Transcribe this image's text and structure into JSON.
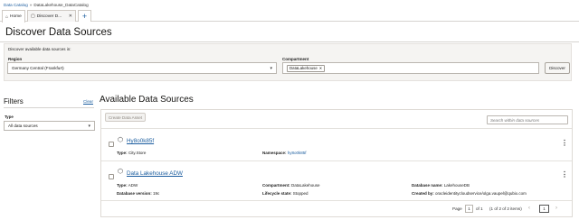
{
  "breadcrumb": {
    "root": "Data Catalog",
    "separator": "»",
    "current": "DataLakehouse_DataCatalog"
  },
  "tabs": [
    {
      "label": "Home"
    },
    {
      "label": "Discover D..."
    }
  ],
  "page_title": "Discover Data Sources",
  "discover": {
    "intro": "Discover available data sources in:",
    "region_label": "Region",
    "region_value": "Germany Central (Frankfurt)",
    "compartment_label": "Compartment",
    "compartment_chip": "DataLakehouse",
    "discover_button": "Discover"
  },
  "filters": {
    "title": "Filters",
    "clear": "Clear",
    "type_label": "Type",
    "type_value": "All data sources"
  },
  "sources": {
    "title": "Available Data Sources",
    "create_button": "Create Data Asset",
    "search_placeholder": "Search within data sources",
    "items": [
      {
        "name": "Hy8o0k85f",
        "type_label": "Type:",
        "type_value": "City.Store",
        "ns_label": "Namespace:",
        "ns_value": "hy8o0k85f"
      },
      {
        "name": "Data Lakehouse ADW",
        "type_label": "Type:",
        "type_value": "ADW",
        "comp_label": "Compartment:",
        "comp_value": "DataLakehouse",
        "dbname_label": "Database name:",
        "dbname_value": "LakehouseDB",
        "dbver_label": "Database version:",
        "dbver_value": "19c",
        "life_label": "Lifecycle state:",
        "life_value": "Stopped",
        "created_label": "Created by:",
        "created_value": "oracleidentitycloudservice/olga.vaupel@qubix.com"
      }
    ],
    "pagination": {
      "page_label": "Page",
      "page_value": "1",
      "of_text": "of 1",
      "count_text": "(1 of 2 of 2 items)",
      "current_page": "1"
    }
  }
}
